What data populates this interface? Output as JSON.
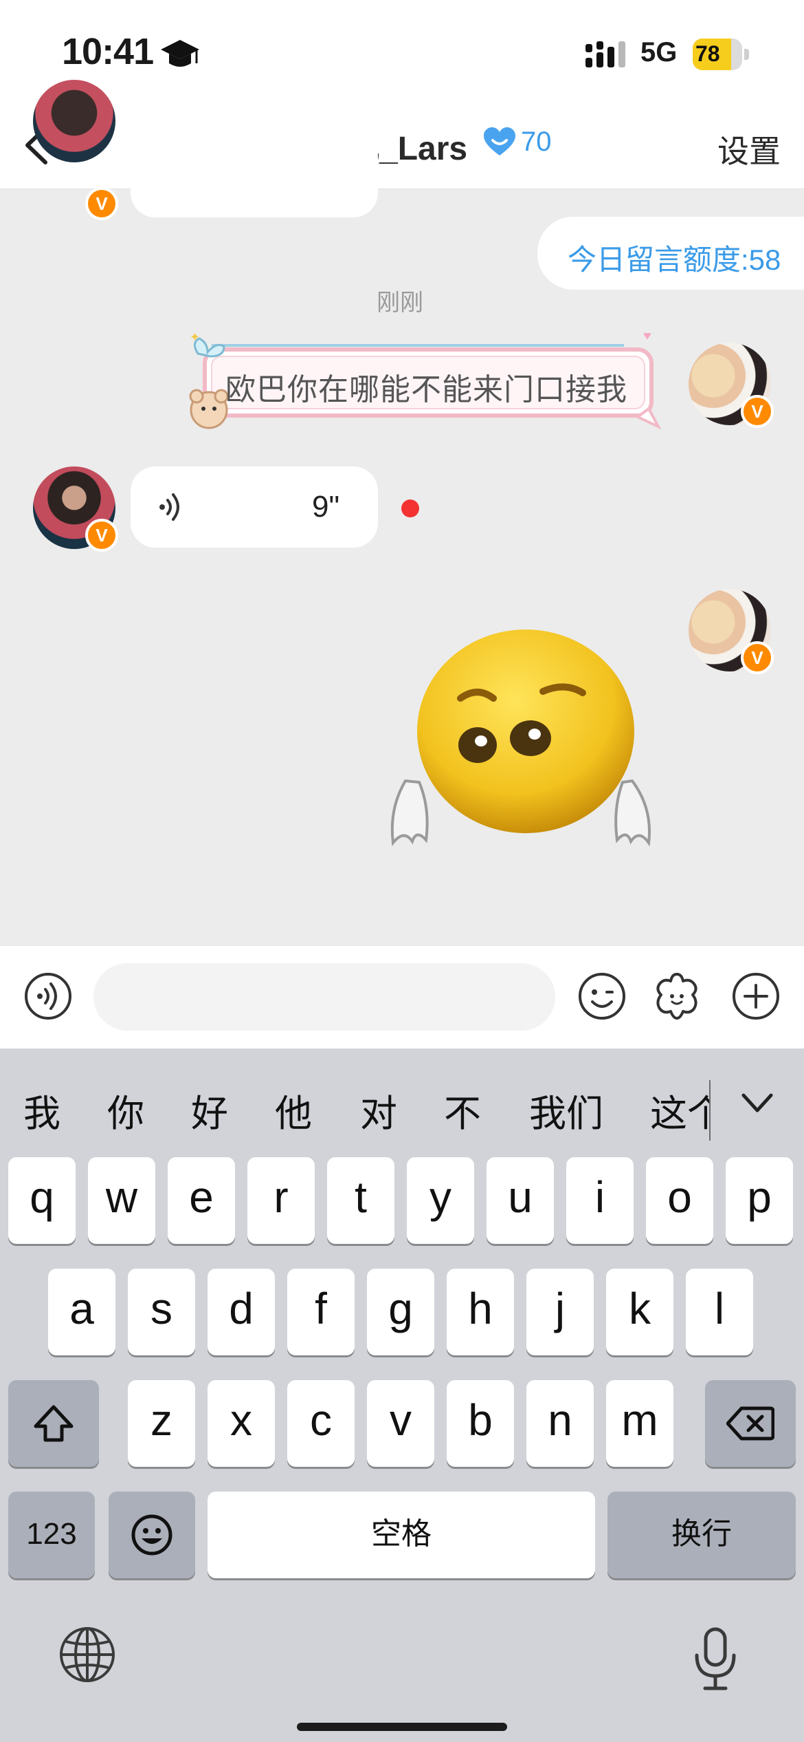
{
  "status_bar": {
    "time": "10:41",
    "network": "5G",
    "battery": "78",
    "battery_fill": 0.78
  },
  "header": {
    "title": "黄子弘凡_Lars",
    "intimacy_score": "70",
    "settings_label": "设置"
  },
  "chat": {
    "quota_message": "今日留言额度:58",
    "time_separator": "刚刚",
    "sent_message": "欧巴你在哪能不能来门口接我",
    "voice_message": {
      "duration": "9\""
    }
  },
  "input": {
    "placeholder": ""
  },
  "keyboard": {
    "candidates": [
      "我",
      "你",
      "好",
      "他",
      "对",
      "不",
      "我们",
      "这个"
    ],
    "row1": [
      "q",
      "w",
      "e",
      "r",
      "t",
      "y",
      "u",
      "i",
      "o",
      "p"
    ],
    "row2": [
      "a",
      "s",
      "d",
      "f",
      "g",
      "h",
      "j",
      "k",
      "l"
    ],
    "row3": [
      "z",
      "x",
      "c",
      "v",
      "b",
      "n",
      "m"
    ],
    "numbers_label": "123",
    "space_label": "空格",
    "return_label": "换行"
  },
  "colors": {
    "accent_blue": "#3b9be8",
    "unread_red": "#f43232",
    "battery_yellow": "#f7cd1d",
    "vip_orange": "#ff8a00"
  }
}
